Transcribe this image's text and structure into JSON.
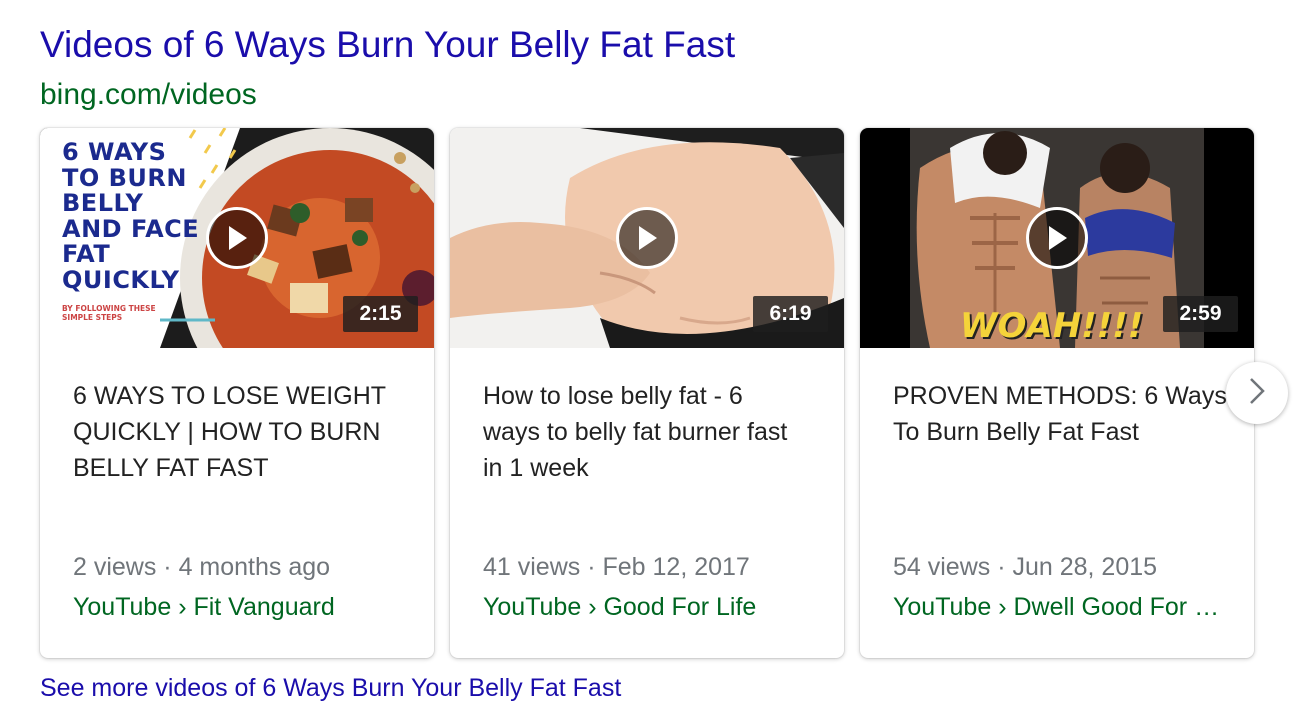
{
  "header": {
    "title": "Videos of 6 Ways Burn Your Belly Fat Fast",
    "source": "bing.com/videos"
  },
  "videos": [
    {
      "duration": "2:15",
      "thumbnail_text": [
        "6 WAYS",
        "TO BURN",
        "BELLY",
        "AND FACE",
        "FAT",
        "QUICKLY"
      ],
      "thumbnail_small_text": [
        "BY FOLLOWING THESE",
        "SIMPLE STEPS"
      ],
      "title_lines": [
        "6 WAYS TO LOSE WEIGHT",
        "QUICKLY | HOW TO BURN",
        "BELLY FAT FAST"
      ],
      "meta": "2 views · 4 months ago",
      "channel": "YouTube › Fit Vanguard"
    },
    {
      "duration": "6:19",
      "title_lines": [
        "How to lose belly fat - 6",
        "ways to belly fat burner fast",
        "in 1 week"
      ],
      "meta": "41 views · Feb 12, 2017",
      "channel": "YouTube › Good For Life"
    },
    {
      "duration": "2:59",
      "thumbnail_text": "WOAH!!!!",
      "title_lines": [
        "PROVEN METHODS: 6 Ways",
        "To Burn Belly Fat Fast"
      ],
      "meta": "54 views · Jun 28, 2015",
      "channel": "YouTube › Dwell Good For …"
    }
  ],
  "see_more": "See more videos of 6 Ways Burn Your Belly Fat Fast",
  "icons": {
    "play": "play-icon",
    "next": "chevron-right-icon"
  },
  "colors": {
    "link": "#1a0dab",
    "source_green": "#006621",
    "meta_gray": "#70757a"
  }
}
